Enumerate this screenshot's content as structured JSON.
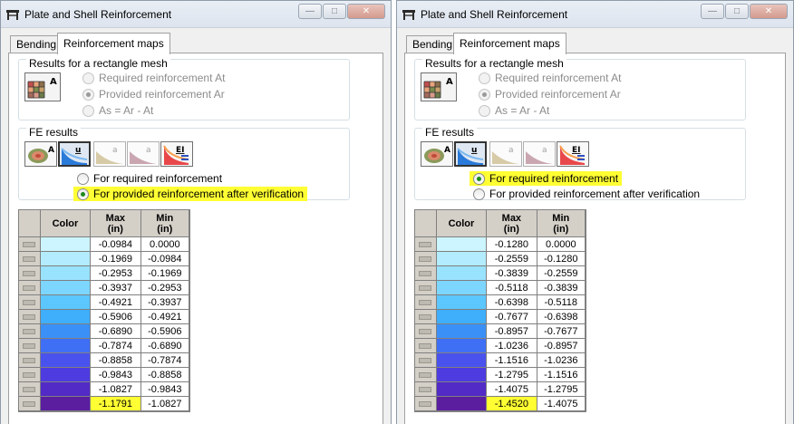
{
  "windows": [
    {
      "title": "Plate and Shell Reinforcement",
      "tabs": [
        "Bending",
        "Reinforcement maps"
      ],
      "rect_group_label": "Results for a rectangle mesh",
      "rect_options": [
        "Required reinforcement At",
        "Provided reinforcement Ar",
        "As = Ar - At"
      ],
      "rect_selected": 1,
      "fe_group_label": "FE results",
      "fe_options": [
        "For required reinforcement",
        "For provided reinforcement after verification"
      ],
      "fe_selected": 1,
      "grid_headers": {
        "color": "Color",
        "max": "Max",
        "max_unit": "(in)",
        "min": "Min",
        "min_unit": "(in)"
      },
      "rows": [
        {
          "color": "#ccf5ff",
          "max": "-0.0984",
          "min": "0.0000"
        },
        {
          "color": "#b3ecff",
          "max": "-0.1969",
          "min": "-0.0984"
        },
        {
          "color": "#99e3ff",
          "max": "-0.2953",
          "min": "-0.1969"
        },
        {
          "color": "#7dd6ff",
          "max": "-0.3937",
          "min": "-0.2953"
        },
        {
          "color": "#5cc7ff",
          "max": "-0.4921",
          "min": "-0.3937"
        },
        {
          "color": "#3faefb",
          "max": "-0.5906",
          "min": "-0.4921"
        },
        {
          "color": "#3b90f7",
          "max": "-0.6890",
          "min": "-0.5906"
        },
        {
          "color": "#3f6ff5",
          "max": "-0.7874",
          "min": "-0.6890"
        },
        {
          "color": "#4a52ee",
          "max": "-0.8858",
          "min": "-0.7874"
        },
        {
          "color": "#4e3ce0",
          "max": "-0.9843",
          "min": "-0.8858"
        },
        {
          "color": "#522ac6",
          "max": "-1.0827",
          "min": "-0.9843"
        },
        {
          "color": "#5a1e9e",
          "max": "-1.1791",
          "min": "-1.0827"
        }
      ],
      "highlight_row": 11
    },
    {
      "title": "Plate and Shell Reinforcement",
      "tabs": [
        "Bending",
        "Reinforcement maps"
      ],
      "rect_group_label": "Results for a rectangle mesh",
      "rect_options": [
        "Required reinforcement At",
        "Provided reinforcement Ar",
        "As = Ar - At"
      ],
      "rect_selected": 1,
      "fe_group_label": "FE results",
      "fe_options": [
        "For required reinforcement",
        "For provided reinforcement after verification"
      ],
      "fe_selected": 0,
      "grid_headers": {
        "color": "Color",
        "max": "Max",
        "max_unit": "(in)",
        "min": "Min",
        "min_unit": "(in)"
      },
      "rows": [
        {
          "color": "#ccf5ff",
          "max": "-0.1280",
          "min": "0.0000"
        },
        {
          "color": "#b3ecff",
          "max": "-0.2559",
          "min": "-0.1280"
        },
        {
          "color": "#99e3ff",
          "max": "-0.3839",
          "min": "-0.2559"
        },
        {
          "color": "#7dd6ff",
          "max": "-0.5118",
          "min": "-0.3839"
        },
        {
          "color": "#5cc7ff",
          "max": "-0.6398",
          "min": "-0.5118"
        },
        {
          "color": "#3faefb",
          "max": "-0.7677",
          "min": "-0.6398"
        },
        {
          "color": "#3b90f7",
          "max": "-0.8957",
          "min": "-0.7677"
        },
        {
          "color": "#3f6ff5",
          "max": "-1.0236",
          "min": "-0.8957"
        },
        {
          "color": "#4a52ee",
          "max": "-1.1516",
          "min": "-1.0236"
        },
        {
          "color": "#4e3ce0",
          "max": "-1.2795",
          "min": "-1.1516"
        },
        {
          "color": "#522ac6",
          "max": "-1.4075",
          "min": "-1.2795"
        },
        {
          "color": "#5a1e9e",
          "max": "-1.4520",
          "min": "-1.4075"
        }
      ],
      "highlight_row": 11
    }
  ],
  "highlight_color": "#ffff33"
}
